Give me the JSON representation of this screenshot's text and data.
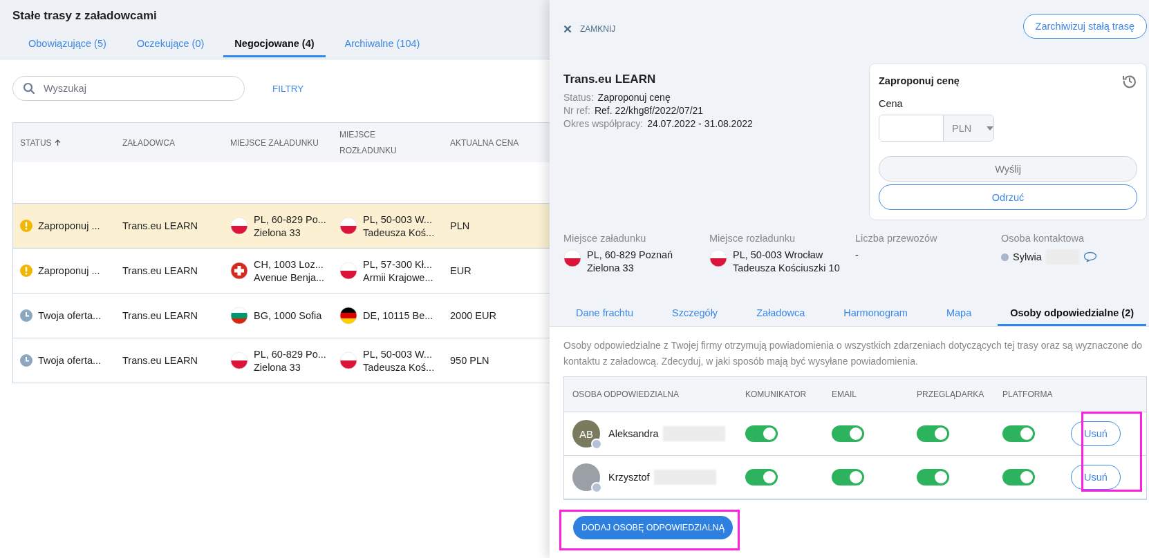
{
  "page": {
    "title": "Stałe trasy z załadowcami"
  },
  "tabs": [
    {
      "label": "Obowiązujące (5)",
      "selected": false
    },
    {
      "label": "Oczekujące (0)",
      "selected": false
    },
    {
      "label": "Negocjowane (4)",
      "selected": true
    },
    {
      "label": "Archiwalne (104)",
      "selected": false
    }
  ],
  "search": {
    "placeholder": "Wyszukaj"
  },
  "filters_label": "FILTRY",
  "table": {
    "columns": [
      "STATUS",
      "ZAŁADOWCA",
      "MIEJSCE ZAŁADUNKU",
      "MIEJSCE ROZŁADUNKU",
      "AKTUALNA CENA"
    ],
    "rows": [
      {
        "selected": true,
        "kind": "warning",
        "status": "Zaproponuj ...",
        "shipper": "Trans.eu LEARN",
        "loading": {
          "kind": "pl",
          "line1": "PL, 60-829 Po...",
          "line2": "Zielona 33"
        },
        "unloading": {
          "kind": "pl",
          "line1": "PL, 50-003 W...",
          "line2": "Tadeusza Koś..."
        },
        "price": "PLN"
      },
      {
        "selected": false,
        "kind": "warning",
        "status": "Zaproponuj ...",
        "shipper": "Trans.eu LEARN",
        "loading": {
          "kind": "ch",
          "line1": "CH, 1003 Loz...",
          "line2": "Avenue Benja..."
        },
        "unloading": {
          "kind": "pl",
          "line1": "PL, 57-300 Kł...",
          "line2": "Armii Krajowe..."
        },
        "price": "EUR"
      },
      {
        "selected": false,
        "kind": "pending",
        "status": "Twoja oferta...",
        "shipper": "Trans.eu LEARN",
        "loading": {
          "kind": "bg",
          "line1": "BG, 1000 Sofia"
        },
        "unloading": {
          "kind": "de",
          "line1": "DE, 10115 Be..."
        },
        "price": "2000 EUR"
      },
      {
        "selected": false,
        "kind": "pending",
        "status": "Twoja oferta...",
        "shipper": "Trans.eu LEARN",
        "loading": {
          "kind": "pl",
          "line1": "PL, 60-829 Po...",
          "line2": "Zielona 33"
        },
        "unloading": {
          "kind": "pl",
          "line1": "PL, 50-003 W...",
          "line2": "Tadeusza Koś..."
        },
        "price": "950 PLN"
      }
    ]
  },
  "drawer": {
    "close_label": "ZAMKNIJ",
    "archive_button": "Zarchiwizuj stałą trasę",
    "company": "Trans.eu LEARN",
    "facts": [
      {
        "label": "Status:",
        "value": "Zaproponuj cenę"
      },
      {
        "label": "Nr ref:",
        "value": "Ref. 22/khg8f/2022/07/21"
      },
      {
        "label": "Okres współpracy:",
        "value": "24.07.2022 - 31.08.2022"
      }
    ],
    "offer": {
      "title": "Zaproponuj cenę",
      "price_label": "Cena",
      "currency": "PLN",
      "send_button": {
        "label": "Wyślij",
        "disabled": true
      },
      "reject_button": "Odrzuć"
    },
    "details": [
      {
        "kind": "place",
        "label": "Miejsce załadunku",
        "line1": "PL, 60-829 Poznań",
        "line2": "Zielona 33"
      },
      {
        "kind": "place",
        "label": "Miejsce rozładunku",
        "line1": "PL, 50-003 Wrocław",
        "line2": "Tadeusza Kościuszki 10"
      },
      {
        "kind": "text",
        "label": "Liczba przewozów",
        "value": "-"
      },
      {
        "kind": "person",
        "label": "Osoba kontaktowa",
        "value": "Sylwia"
      }
    ],
    "tabs": [
      {
        "label": "Dane frachtu",
        "selected": false
      },
      {
        "label": "Szczegóły",
        "selected": false
      },
      {
        "label": "Załadowca",
        "selected": false
      },
      {
        "label": "Harmonogram",
        "selected": false
      },
      {
        "label": "Mapa",
        "selected": false
      },
      {
        "label": "Osoby odpowiedzialne (2)",
        "selected": true
      }
    ],
    "description": "Osoby odpowiedzialne z Twojej firmy otrzymują powiadomienia o wszystkich zdarzeniach dotyczących tej trasy oraz są wyznaczone do kontaktu z załadowcą. Zdecyduj, w jaki sposób mają być wysyłane powiadomienia.",
    "people_table": {
      "columns": [
        "OSOBA ODPOWIEDZIALNA",
        "KOMUNIKATOR",
        "EMAIL",
        "PRZEGLĄDARKA",
        "PLATFORMA"
      ],
      "rows": [
        {
          "kind": "initials",
          "initials": "AB",
          "name": "Aleksandra",
          "toggles": [
            {
              "on": true
            },
            {
              "on": true
            },
            {
              "on": true
            },
            {
              "on": true
            }
          ],
          "remove_button": "Usuń"
        },
        {
          "kind": "photo",
          "name": "Krzysztof",
          "toggles": [
            {
              "on": true
            },
            {
              "on": true
            },
            {
              "on": true
            },
            {
              "on": true
            }
          ],
          "remove_button": "Usuń"
        }
      ]
    },
    "add_button": "DODAJ OSOBĘ ODPOWIEDZIALNĄ"
  }
}
